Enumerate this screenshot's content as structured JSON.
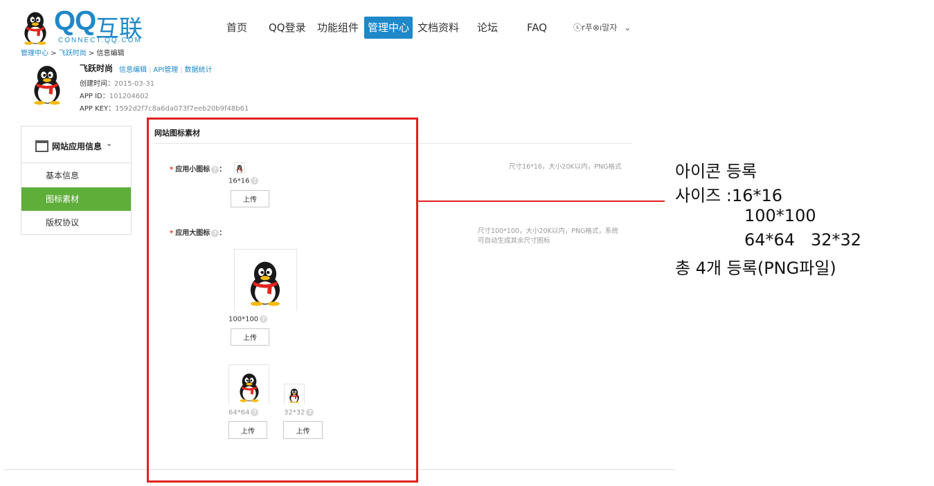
{
  "logo": {
    "qq": "QQ",
    "cn": "互联",
    "sub": "CONNECT.QQ.COM"
  },
  "nav": {
    "items": [
      {
        "label": "首页"
      },
      {
        "label": "QQ登录"
      },
      {
        "label": "功能组件"
      },
      {
        "label": "管理中心",
        "active": true
      },
      {
        "label": "文档资料"
      },
      {
        "label": "论坛"
      },
      {
        "label": "FAQ"
      }
    ],
    "user": "ⓢr푸⊗ı말자",
    "user_caret": "⌄"
  },
  "breadcrumb": {
    "root": "管理中心",
    "sep": " > ",
    "mid": "飞跃时尚",
    "current": "信息编辑"
  },
  "app": {
    "name": "飞跃时尚",
    "links": [
      "信息编辑",
      "API管理",
      "数据统计"
    ],
    "created_label": "创建时间：",
    "created_value": "2015-03-31",
    "id_label": "APP ID：",
    "id_value": "101204602",
    "key_label": "APP KEY：",
    "key_value": "1592d2f7c8a6da073f7eeb20b9f48b61"
  },
  "sidebar": {
    "header": "网站应用信息",
    "header_caret": "⌄",
    "items": [
      {
        "label": "基本信息"
      },
      {
        "label": "图标素材",
        "active": true
      },
      {
        "label": "版权协议"
      }
    ]
  },
  "main": {
    "title": "网站图标素材",
    "small_icon": {
      "required": "*",
      "label": "应用小图标",
      "colon": "：",
      "size": "16*16",
      "upload": "上传",
      "hint": "尺寸16*16，大小20K以内，PNG格式"
    },
    "large_icon": {
      "required": "*",
      "label": "应用大图标",
      "colon": "：",
      "size": "100*100",
      "upload": "上传",
      "hint_line1": "尺寸100*100，大小20K以内，PNG格式，系统",
      "hint_line2": "可自动生成其余尺寸图标"
    },
    "icon64": {
      "size": "64*64",
      "upload": "上传"
    },
    "icon32": {
      "size": "32*32",
      "upload": "上传"
    },
    "help_glyph": "?"
  },
  "annotation": {
    "line1": "아이콘 등록",
    "line2": "사이즈 :16*16",
    "line3": "100*100",
    "line4": "64*64   32*32",
    "line5": "총 4개 등록(PNG파일)"
  },
  "colors": {
    "brand": "#1e88c9",
    "active_green": "#5fae3a",
    "annotation_red": "#e02020",
    "required": "#e8350f"
  }
}
